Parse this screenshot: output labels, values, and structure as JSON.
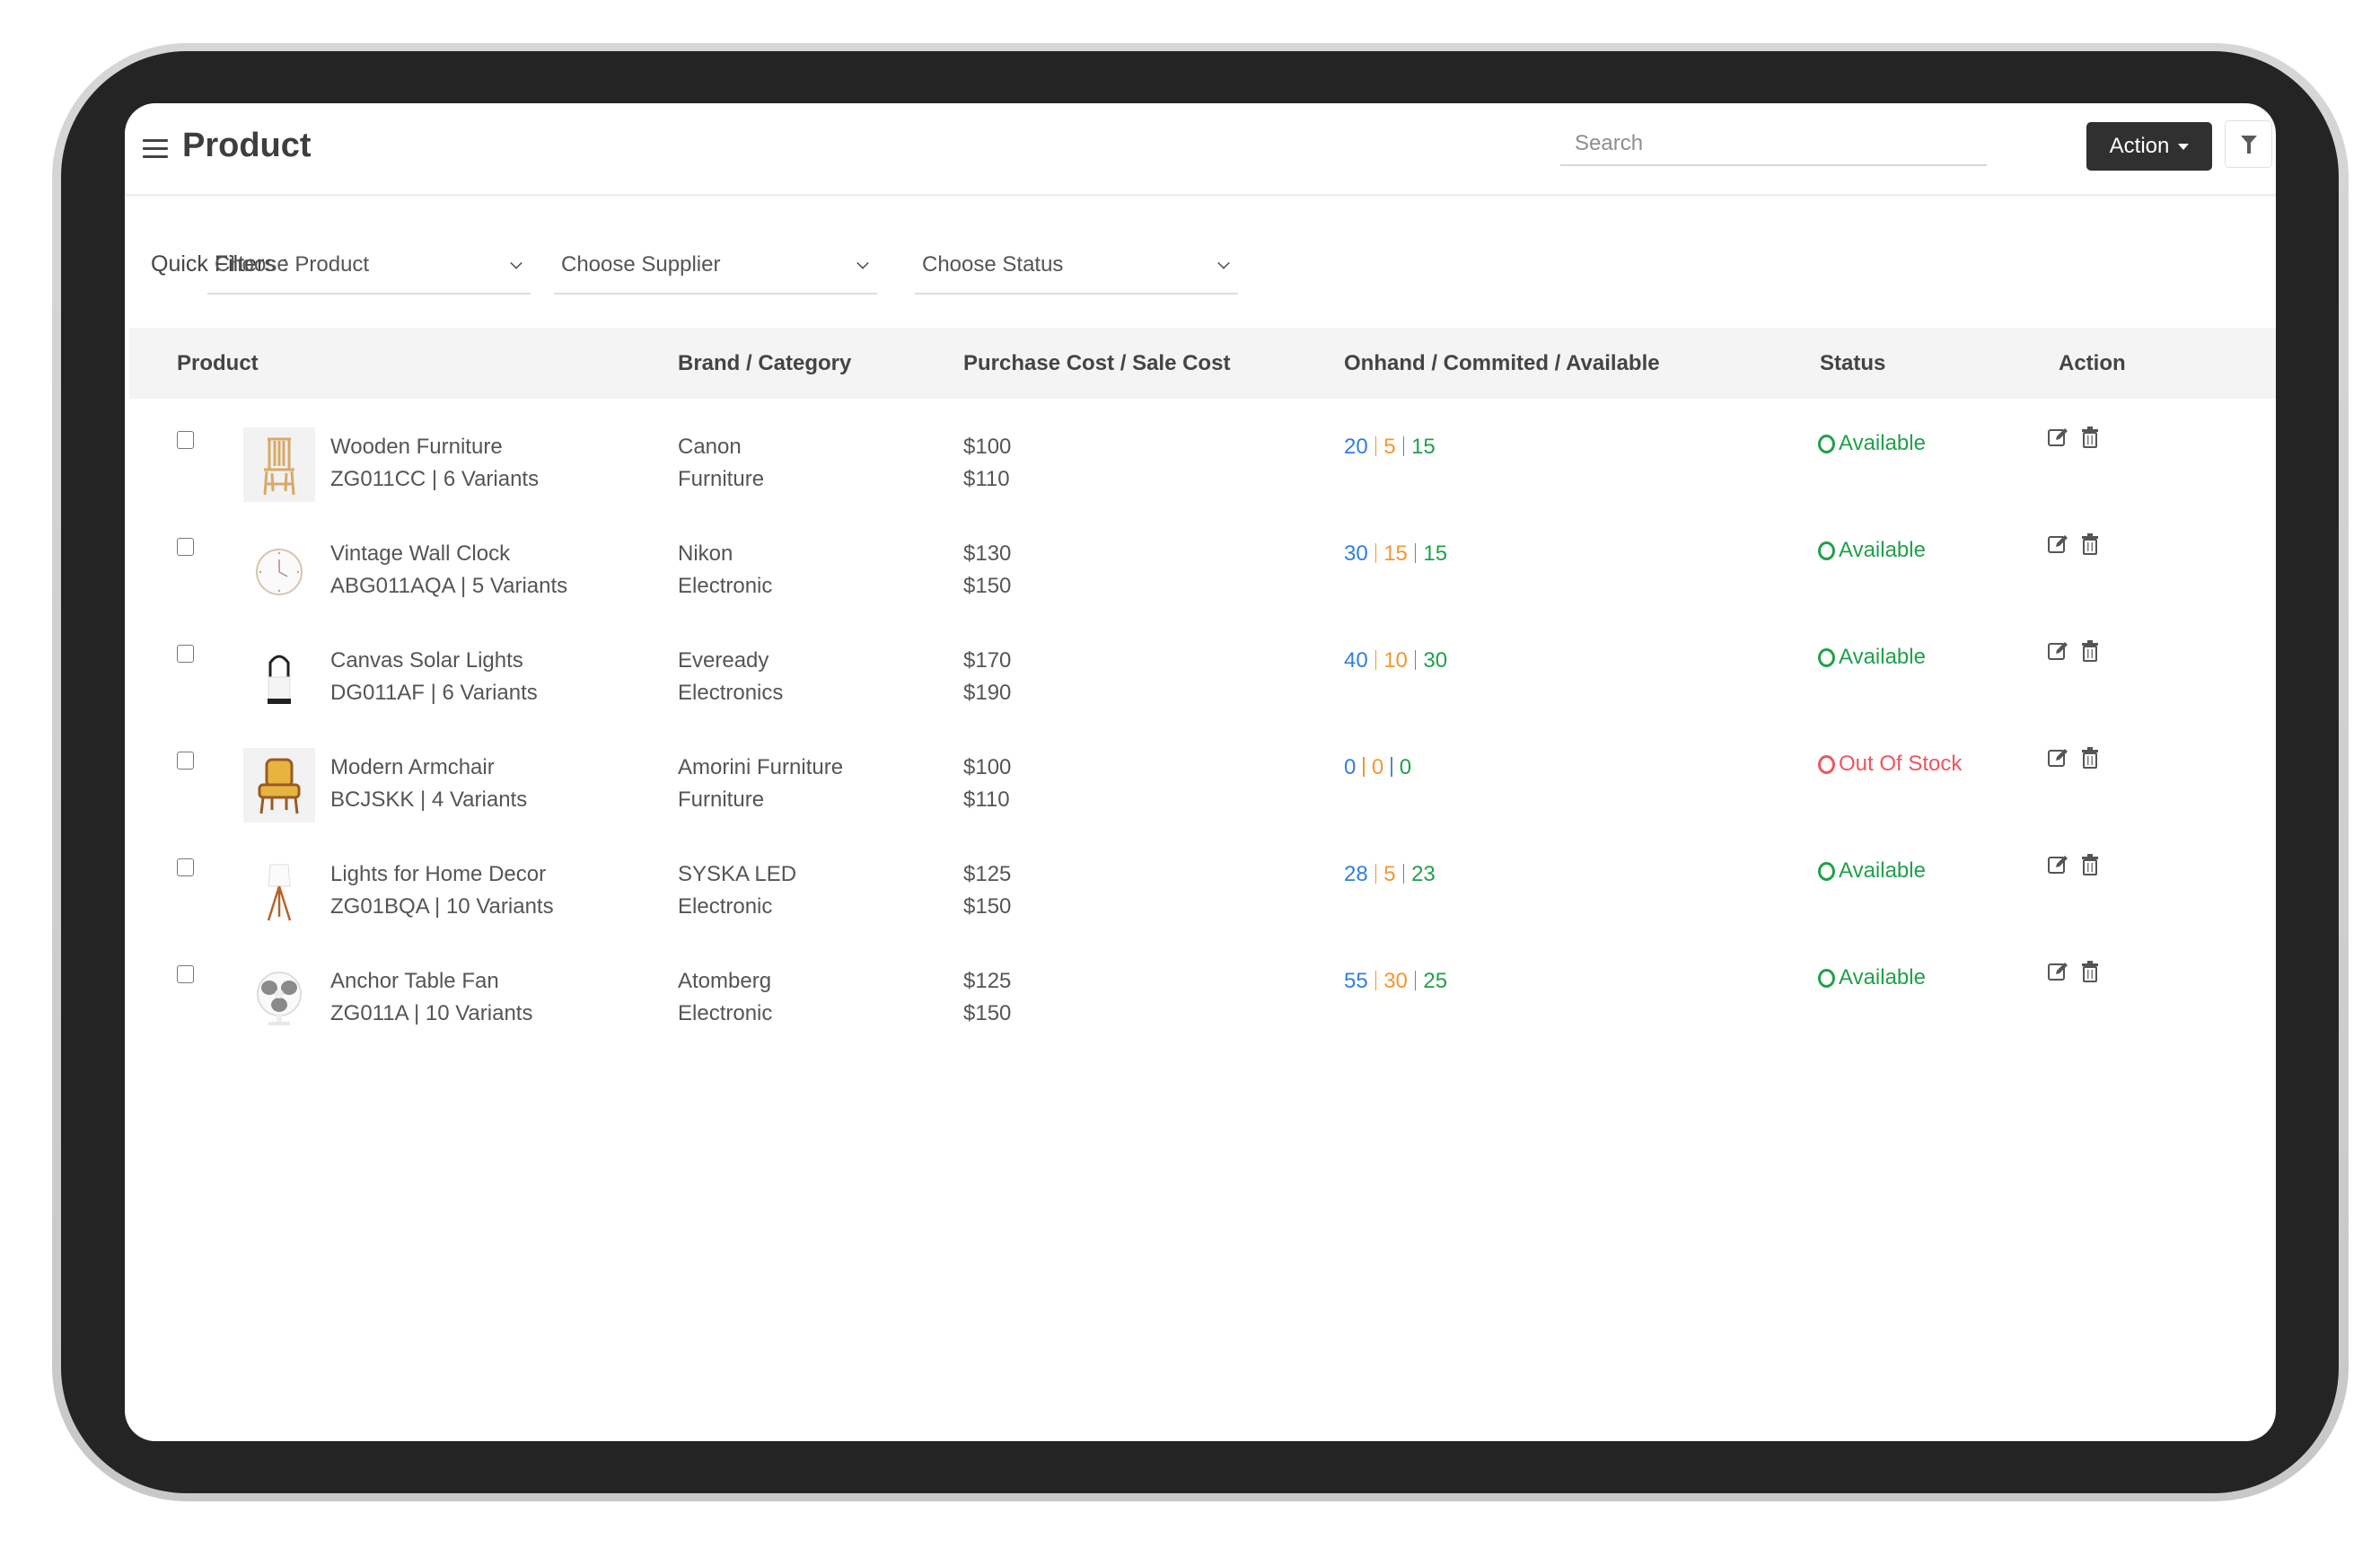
{
  "header": {
    "title": "Product",
    "search_placeholder": "Search",
    "action_label": "Action"
  },
  "quick_filters": {
    "label": "Quick Filters :",
    "selects": [
      {
        "value": "Choose Product"
      },
      {
        "value": "Choose Supplier"
      },
      {
        "value": "Choose Status"
      }
    ]
  },
  "table": {
    "columns": [
      "Product",
      "Brand / Category",
      "Purchase Cost / Sale Cost",
      "Onhand / Commited / Available",
      "Status",
      "Action"
    ],
    "rows": [
      {
        "name": "Wooden Furniture",
        "sku_variants": "ZG011CC | 6 Variants",
        "brand": "Canon",
        "category": "Furniture",
        "purchase": "$100",
        "sale": "$110",
        "onhand": "20",
        "committed": "5",
        "available": "15",
        "status": "Available",
        "status_type": "ok",
        "thumb": "chair-image"
      },
      {
        "name": "Vintage Wall Clock",
        "sku_variants": "ABG011AQA | 5 Variants",
        "brand": "Nikon",
        "category": "Electronic",
        "purchase": "$130",
        "sale": "$150",
        "onhand": "30",
        "committed": "15",
        "available": "15",
        "status": "Available",
        "status_type": "ok",
        "thumb": "clock-image"
      },
      {
        "name": "Canvas Solar Lights",
        "sku_variants": "DG011AF | 6 Variants",
        "brand": "Eveready",
        "category": "Electronics",
        "purchase": "$170",
        "sale": "$190",
        "onhand": "40",
        "committed": "10",
        "available": "30",
        "status": "Available",
        "status_type": "ok",
        "thumb": "lantern-image"
      },
      {
        "name": "Modern Armchair",
        "sku_variants": "BCJSKK | 4 Variants",
        "brand": "Amorini Furniture",
        "category": "Furniture",
        "purchase": "$100",
        "sale": "$110",
        "onhand": "0",
        "committed": "0",
        "available": "0",
        "status": "Out Of Stock",
        "status_type": "bad",
        "thumb": "armchair-image"
      },
      {
        "name": "Lights for Home Decor",
        "sku_variants": "ZG01BQA | 10 Variants",
        "brand": "SYSKA LED",
        "category": "Electronic",
        "purchase": "$125",
        "sale": "$150",
        "onhand": "28",
        "committed": "5",
        "available": "23",
        "status": "Available",
        "status_type": "ok",
        "thumb": "lamp-image"
      },
      {
        "name": "Anchor Table Fan",
        "sku_variants": "ZG011A | 10 Variants",
        "brand": "Atomberg",
        "category": "Electronic",
        "purchase": "$125",
        "sale": "$150",
        "onhand": "55",
        "committed": "30",
        "available": "25",
        "status": "Available",
        "status_type": "ok",
        "thumb": "fan-image"
      }
    ]
  },
  "colors": {
    "onhand": "#2f7fe0",
    "committed": "#f5962e",
    "available": "#20a04a",
    "status_ok": "#20a04a",
    "status_bad": "#f0545c",
    "action_button": "#303030"
  }
}
